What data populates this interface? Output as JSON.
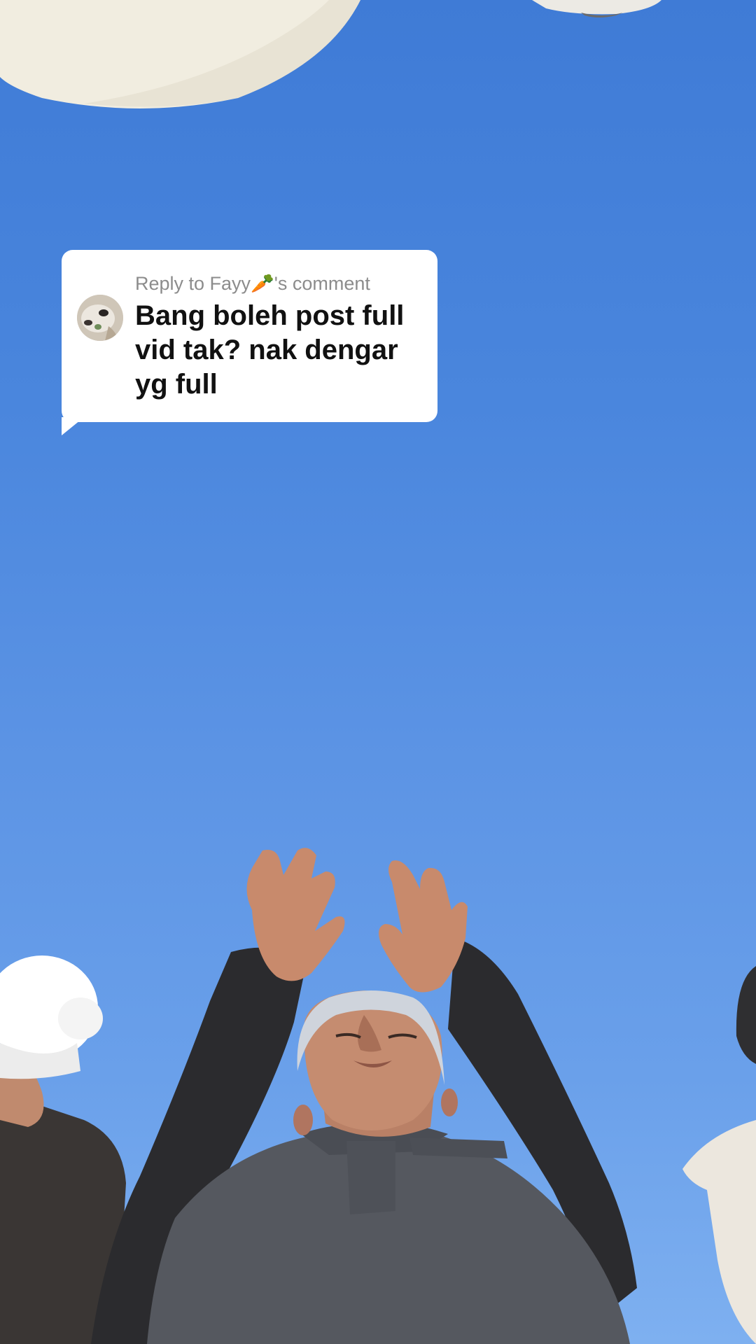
{
  "reply_sticker": {
    "header_prefix": "Reply to Fayy",
    "header_emoji": "🥕",
    "header_suffix": "'s comment",
    "comment_text": "Bang boleh post full vid tak? nak dengar yg full",
    "avatar_icon": "profile-photo-icon"
  },
  "colors": {
    "sky_top": "#3f7bd6",
    "sky_bottom": "#7eb0f0",
    "card_background": "#ffffff",
    "header_text": "#8c8c8c",
    "comment_text": "#111111"
  }
}
